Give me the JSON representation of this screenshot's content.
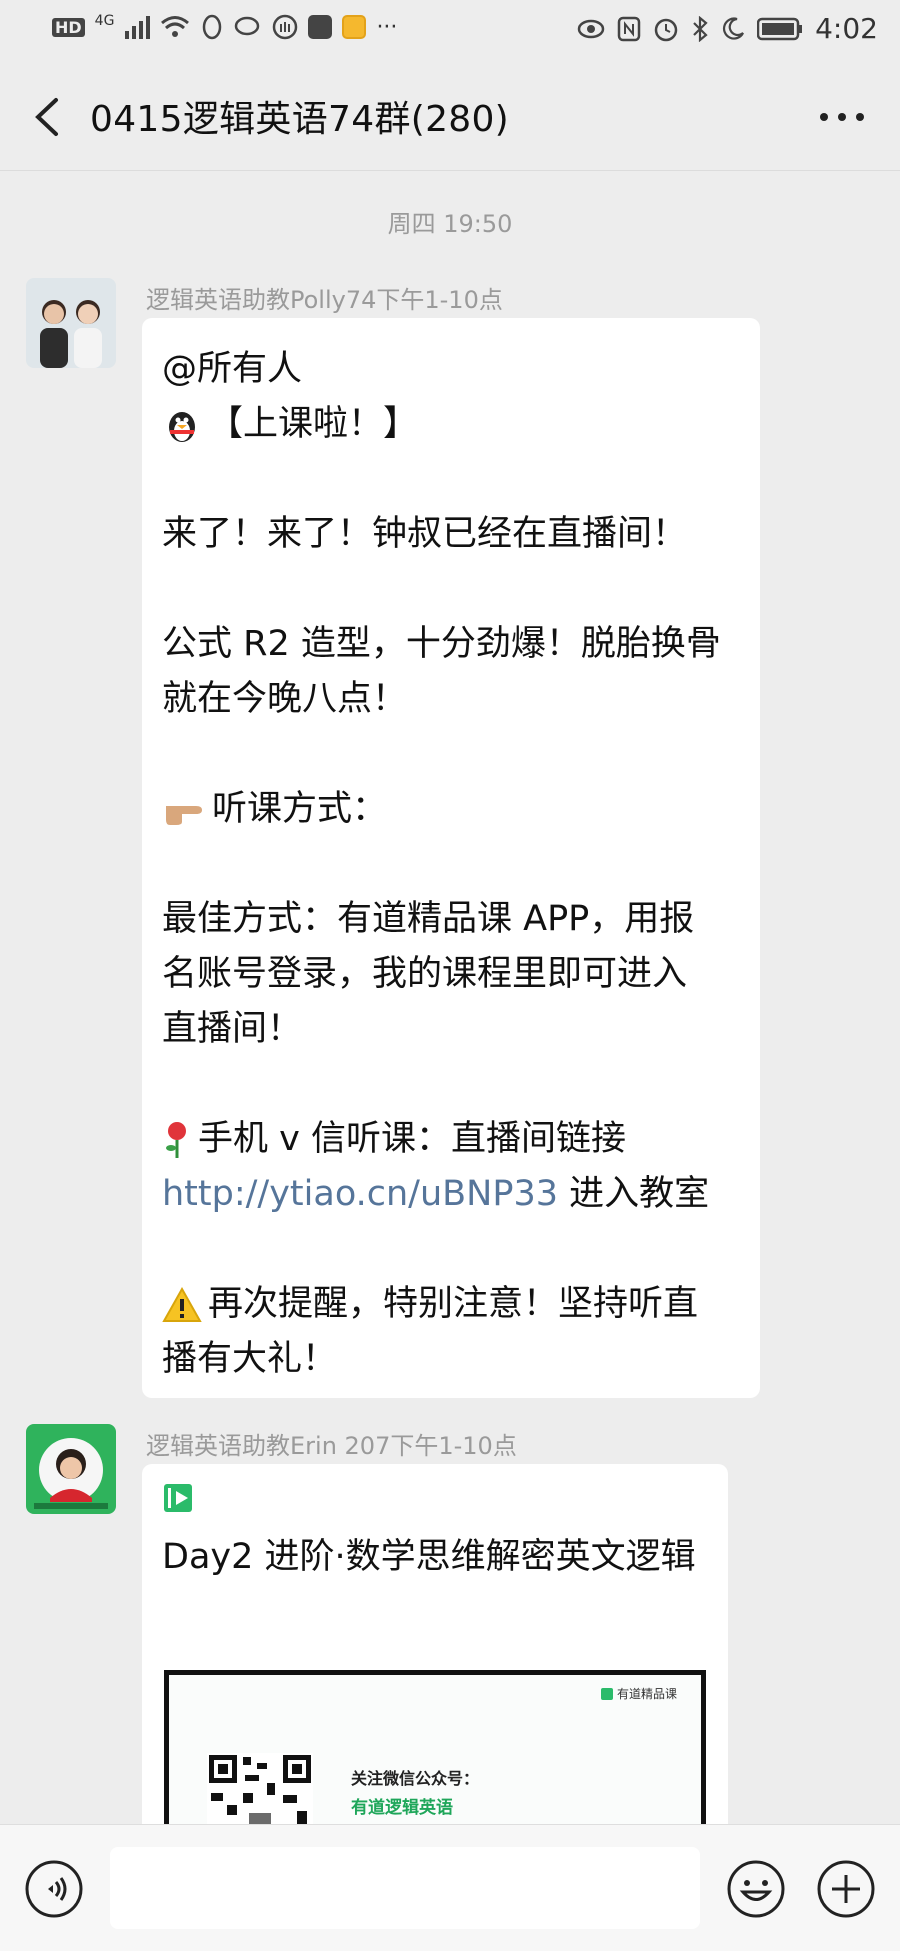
{
  "status_bar": {
    "network": "HD",
    "signal": "4G",
    "time": "4:02",
    "more": "···"
  },
  "header": {
    "title": "0415逻辑英语74群(280)"
  },
  "chat": {
    "timestamp": "周四 19:50",
    "messages": [
      {
        "sender": "逻辑英语助教Polly74下午1-10点",
        "lines": {
          "l1": "@所有人",
          "l2": "【上课啦！】",
          "l3": "来了！来了！钟叔已经在直播间！",
          "l4": "公式 R2 造型，十分劲爆！脱胎换骨",
          "l5": "就在今晚八点！",
          "l6": "听课方式：",
          "l7": "最佳方式：有道精品课 APP，用报",
          "l8": "名账号登录，我的课程里即可进入",
          "l9": "直播间！",
          "l10": "手机 v 信听课：直播间链接",
          "l11_link": "http://ytiao.cn/uBNP33",
          "l11_rest": " 进入教室",
          "l12": "再次提醒，特别注意！坚持听直",
          "l13": "播有大礼！"
        },
        "emoji": {
          "l2": "penguin-emoji",
          "l6": "pointing-hand-emoji",
          "l10": "rose-emoji",
          "l12": "warning-emoji"
        }
      },
      {
        "sender": "逻辑英语助教Erin 207下午1-10点",
        "card_title": "Day2 进阶·数学思维解密英文逻辑",
        "thumb_brand": "有道精品课",
        "thumb_line1": "关注微信公众号：",
        "thumb_line2": "有道逻辑英语"
      }
    ]
  },
  "colors": {
    "background": "#ededed",
    "bubble": "#ffffff",
    "link": "#56759a",
    "accent_green": "#1fa65a"
  }
}
